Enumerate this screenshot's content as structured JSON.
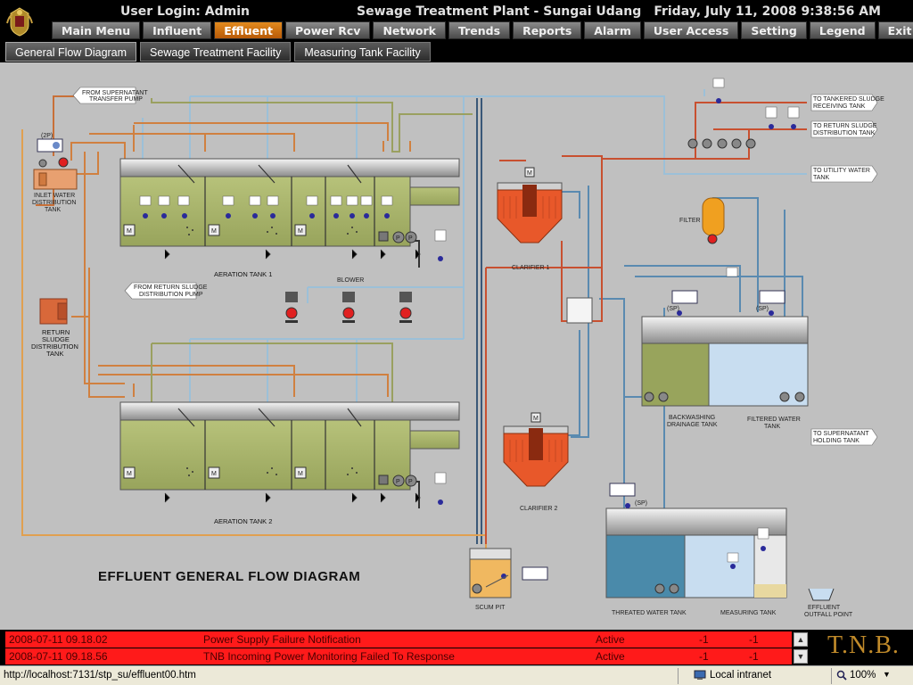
{
  "header": {
    "user_login": "User Login: Admin",
    "plant_title": "Sewage Treatment Plant - Sungai Udang",
    "datetime": "Friday, July 11, 2008 9:38:56 AM"
  },
  "menu": [
    {
      "label": "Main Menu",
      "active": false
    },
    {
      "label": "Influent",
      "active": false
    },
    {
      "label": "Effluent",
      "active": true
    },
    {
      "label": "Power Rcv",
      "active": false
    },
    {
      "label": "Network",
      "active": false
    },
    {
      "label": "Trends",
      "active": false
    },
    {
      "label": "Reports",
      "active": false
    },
    {
      "label": "Alarm",
      "active": false
    },
    {
      "label": "User Access",
      "active": false
    },
    {
      "label": "Setting",
      "active": false
    },
    {
      "label": "Legend",
      "active": false
    },
    {
      "label": "Exit",
      "active": false
    }
  ],
  "subtabs": [
    {
      "label": "General Flow Diagram",
      "active": true
    },
    {
      "label": "Sewage Treatment Facility",
      "active": false
    },
    {
      "label": "Measuring Tank Facility",
      "active": false
    }
  ],
  "diagram": {
    "title": "EFFLUENT GENERAL FLOW DIAGRAM",
    "labels": {
      "from_supernatant_1": "FROM SUPERNATANT",
      "from_supernatant_2": "TRANSFER PUMP",
      "inlet_1": "INLET WATER",
      "inlet_2": "DISTRIBUTION",
      "inlet_3": "TANK",
      "inlet_count": "(2P)",
      "aeration1": "AERATION TANK 1",
      "aeration2": "AERATION TANK 2",
      "blower": "BLOWER",
      "from_return_1": "FROM RETURN SLUDGE",
      "from_return_2": "DISTRIBUTION PUMP",
      "return_1": "RETURN",
      "return_2": "SLUDGE",
      "return_3": "DISTRIBUTION",
      "return_4": "TANK",
      "clarifier1": "CLARIFIER 1",
      "clarifier2": "CLARIFIER 2",
      "scum_pit": "SCUM PIT",
      "filter": "FILTER",
      "backwash_1": "BACKWASHING",
      "backwash_2": "DRAINAGE TANK",
      "filtered_1": "FILTERED WATER",
      "filtered_2": "TANK",
      "threated": "THREATED WATER TANK",
      "measuring": "MEASURING TANK",
      "outfall_1": "EFFLUENT",
      "outfall_2": "OUTFALL POINT",
      "to_tankered_1": "TO TANKERED SLUDGE",
      "to_tankered_2": "RECEIVING TANK",
      "to_return_1": "TO RETURN SLUDGE",
      "to_return_2": "DISTRIBUTION TANK",
      "to_utility_1": "TO UTILITY WATER",
      "to_utility_2": "TANK",
      "to_supernatant_1": "TO SUPERNATANT",
      "to_supernatant_2": "HOLDING TANK",
      "sp": "(SP)",
      "motor": "M",
      "pump": "P"
    }
  },
  "alarms": [
    {
      "time": "2008-07-11 09.18.02",
      "message": "Power Supply Failure Notification",
      "state": "Active",
      "v1": "-1",
      "v2": "-1"
    },
    {
      "time": "2008-07-11 09.18.56",
      "message": "TNB Incoming Power Monitoring Failed To Response",
      "state": "Active",
      "v1": "-1",
      "v2": "-1"
    }
  ],
  "brand": "T.N.B.",
  "statusbar": {
    "url": "http://localhost:7131/stp_su/effluent00.htm",
    "zone": "Local intranet",
    "zoom": "100%"
  }
}
